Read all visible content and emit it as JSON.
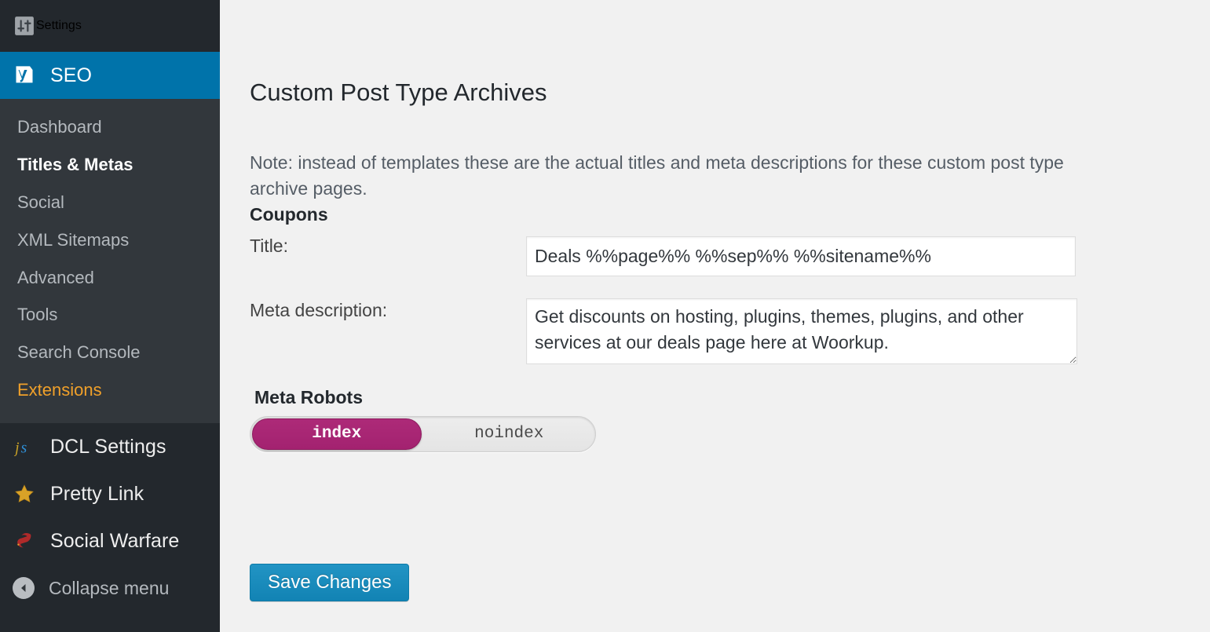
{
  "sidebar": {
    "top_item": {
      "label": "Settings",
      "icon": "sliders-icon"
    },
    "active_item": {
      "label": "SEO",
      "icon": "yoast-icon"
    },
    "submenu": [
      {
        "label": "Dashboard",
        "state": "normal"
      },
      {
        "label": "Titles & Metas",
        "state": "current"
      },
      {
        "label": "Social",
        "state": "normal"
      },
      {
        "label": "XML Sitemaps",
        "state": "normal"
      },
      {
        "label": "Advanced",
        "state": "normal"
      },
      {
        "label": "Tools",
        "state": "normal"
      },
      {
        "label": "Search Console",
        "state": "normal"
      },
      {
        "label": "Extensions",
        "state": "highlight"
      }
    ],
    "plugins": [
      {
        "label": "DCL Settings",
        "icon": "js-icon"
      },
      {
        "label": "Pretty Link",
        "icon": "star-icon"
      },
      {
        "label": "Social Warfare",
        "icon": "social-warfare-icon"
      }
    ],
    "collapse": {
      "label": "Collapse menu",
      "icon": "collapse-arrow-icon"
    }
  },
  "main": {
    "page_title": "Custom Post Type Archives",
    "note": "Note: instead of templates these are the actual titles and meta descriptions for these custom post type archive pages.",
    "cpt_name": "Coupons",
    "title_field": {
      "label": "Title:",
      "value": "Deals %%page%% %%sep%% %%sitename%%",
      "placeholder": ""
    },
    "meta_field": {
      "label": "Meta description:",
      "value": "Get discounts on hosting, plugins, themes, plugins, and other services at our deals page here at Woorkup.",
      "placeholder": ""
    },
    "meta_robots": {
      "label": "Meta Robots",
      "options": [
        "index",
        "noindex"
      ],
      "selected": "index"
    },
    "save_label": "Save Changes"
  },
  "colors": {
    "wp_blue": "#0073aa",
    "sidebar_dark": "#23282d",
    "submenu_dark": "#32373c",
    "highlight_orange": "#f0a02a",
    "toggle_magenta": "#a32270",
    "button_blue": "#1283b4",
    "content_bg": "#f1f1f1"
  }
}
